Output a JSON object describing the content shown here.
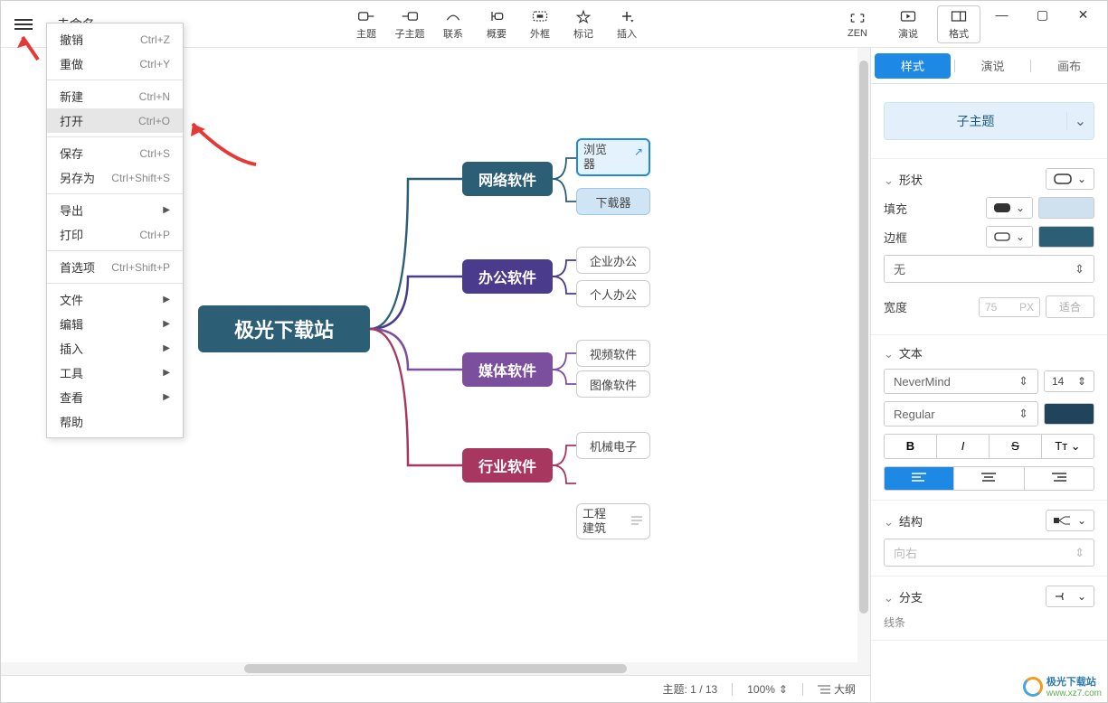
{
  "title": "未命名",
  "menu": {
    "items": [
      {
        "label": "撤销",
        "shortcut": "Ctrl+Z"
      },
      {
        "label": "重做",
        "shortcut": "Ctrl+Y"
      },
      null,
      {
        "label": "新建",
        "shortcut": "Ctrl+N"
      },
      {
        "label": "打开",
        "shortcut": "Ctrl+O",
        "highlighted": true
      },
      null,
      {
        "label": "保存",
        "shortcut": "Ctrl+S"
      },
      {
        "label": "另存为",
        "shortcut": "Ctrl+Shift+S"
      },
      null,
      {
        "label": "导出",
        "submenu": true
      },
      {
        "label": "打印",
        "shortcut": "Ctrl+P"
      },
      null,
      {
        "label": "首选项",
        "shortcut": "Ctrl+Shift+P"
      },
      null,
      {
        "label": "文件",
        "submenu": true
      },
      {
        "label": "编辑",
        "submenu": true
      },
      {
        "label": "插入",
        "submenu": true
      },
      {
        "label": "工具",
        "submenu": true
      },
      {
        "label": "查看",
        "submenu": true
      },
      {
        "label": "帮助"
      }
    ]
  },
  "toolbar": {
    "items": [
      {
        "label": "主题"
      },
      {
        "label": "子主题"
      },
      {
        "label": "联系"
      },
      {
        "label": "概要"
      },
      {
        "label": "外框"
      },
      {
        "label": "标记"
      },
      {
        "label": "插入"
      }
    ],
    "right": [
      {
        "label": "ZEN"
      },
      {
        "label": "演说"
      },
      {
        "label": "格式",
        "active": true
      }
    ]
  },
  "mindmap": {
    "root": "极光下载站",
    "branches": [
      {
        "label": "网络软件",
        "color": "#2c5e76",
        "leaves": [
          {
            "label": "浏览器",
            "selected": true,
            "multiline": true
          },
          {
            "label": "下载器",
            "bg": "#cfe5f5"
          }
        ]
      },
      {
        "label": "办公软件",
        "color": "#4a3b8c",
        "leaves": [
          {
            "label": "企业办公"
          },
          {
            "label": "个人办公"
          }
        ]
      },
      {
        "label": "媒体软件",
        "color": "#7c4f9e",
        "leaves": [
          {
            "label": "视频软件"
          },
          {
            "label": "图像软件"
          }
        ]
      },
      {
        "label": "行业软件",
        "color": "#a8375f",
        "leaves": [
          {
            "label": "机械电子"
          },
          {
            "label": "工程建筑",
            "multiline": true,
            "hasmenu": true
          }
        ]
      }
    ]
  },
  "panel": {
    "tabs": [
      {
        "label": "样式",
        "active": true
      },
      {
        "label": "演说"
      },
      {
        "label": "画布"
      }
    ],
    "subtopic": "子主题",
    "shape": {
      "head": "形状"
    },
    "fill": {
      "label": "填充"
    },
    "border": {
      "label": "边框"
    },
    "border_style": "无",
    "width": {
      "label": "宽度",
      "value": "75",
      "unit": "PX",
      "auto": "适合"
    },
    "text": {
      "head": "文本",
      "font": "NeverMind",
      "size": "14",
      "weight": "Regular",
      "styles": {
        "bold": "B",
        "italic": "I",
        "strike": "S",
        "case": "Tᴛ"
      },
      "align": [
        "left",
        "center",
        "right"
      ]
    },
    "structure": {
      "head": "结构",
      "direction": "向右"
    },
    "branch": {
      "head": "分支",
      "line": "线条"
    }
  },
  "colors": {
    "fill_swatch": "#cfe0ee",
    "border_swatch": "#2c5e76",
    "text_swatch": "#20445c"
  },
  "status": {
    "topic": "主题: 1 / 13",
    "zoom": "100%",
    "outline": "大纲"
  },
  "watermark": {
    "text1": "极光下载站",
    "text2": "www.xz7.com"
  }
}
